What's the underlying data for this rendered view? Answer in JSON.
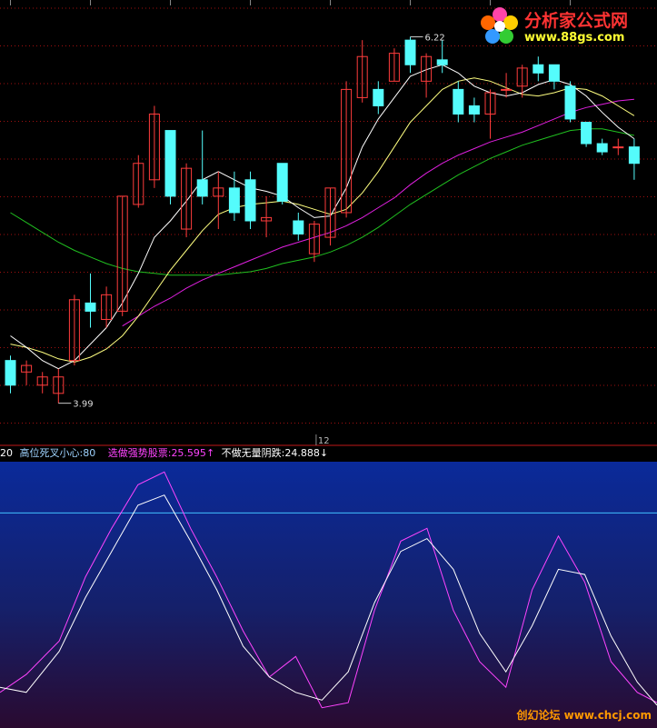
{
  "watermark": {
    "title": "分析家公式网",
    "url": "www.88gs.com"
  },
  "footer_watermark": "创幻论坛 www.chcj.com",
  "info_bar": {
    "period": "20",
    "item1_label": "高位死叉小心:",
    "item1_value": "80",
    "item2_label": "选做强势股票:",
    "item2_value": "25.595",
    "item2_arrow": "↑",
    "item3_label": "不做无量阴跌:",
    "item3_value": "24.888",
    "item3_arrow": "↓"
  },
  "colors": {
    "up": "#ff3c3c",
    "down": "#54fcfc",
    "ma_short": "#ffffff",
    "ma_mid": "#ffff80",
    "ma_magenta": "#e020e0",
    "ma_green": "#20c020",
    "osc_magenta": "#ff44ff",
    "osc_white": "#ffffff",
    "osc_threshold": "#40c0ff",
    "grid": "#a01010"
  },
  "chart_data": [
    {
      "type": "candlestick",
      "price_range": [
        3.8,
        6.4
      ],
      "high_label": "6.22",
      "low_label": "3.99",
      "x_marker": "12",
      "candles": [
        {
          "o": 4.25,
          "h": 4.28,
          "l": 4.05,
          "c": 4.1
        },
        {
          "o": 4.18,
          "h": 4.25,
          "l": 4.1,
          "c": 4.22
        },
        {
          "o": 4.1,
          "h": 4.18,
          "l": 4.05,
          "c": 4.15
        },
        {
          "o": 4.05,
          "h": 4.2,
          "l": 3.99,
          "c": 4.15
        },
        {
          "o": 4.25,
          "h": 4.65,
          "l": 4.22,
          "c": 4.62
        },
        {
          "o": 4.6,
          "h": 4.78,
          "l": 4.45,
          "c": 4.55
        },
        {
          "o": 4.5,
          "h": 4.7,
          "l": 4.45,
          "c": 4.65
        },
        {
          "o": 4.55,
          "h": 5.25,
          "l": 4.52,
          "c": 5.25
        },
        {
          "o": 5.2,
          "h": 5.5,
          "l": 5.18,
          "c": 5.45
        },
        {
          "o": 5.35,
          "h": 5.8,
          "l": 5.3,
          "c": 5.75
        },
        {
          "o": 5.65,
          "h": 5.65,
          "l": 5.2,
          "c": 5.25
        },
        {
          "o": 5.05,
          "h": 5.45,
          "l": 5.0,
          "c": 5.42
        },
        {
          "o": 5.35,
          "h": 5.65,
          "l": 5.2,
          "c": 5.25
        },
        {
          "o": 5.25,
          "h": 5.4,
          "l": 5.05,
          "c": 5.3
        },
        {
          "o": 5.3,
          "h": 5.4,
          "l": 5.1,
          "c": 5.15
        },
        {
          "o": 5.35,
          "h": 5.4,
          "l": 5.05,
          "c": 5.1
        },
        {
          "o": 5.1,
          "h": 5.25,
          "l": 5.0,
          "c": 5.12
        },
        {
          "o": 5.45,
          "h": 5.45,
          "l": 5.2,
          "c": 5.22
        },
        {
          "o": 5.1,
          "h": 5.15,
          "l": 4.98,
          "c": 5.02
        },
        {
          "o": 4.9,
          "h": 5.1,
          "l": 4.85,
          "c": 5.08
        },
        {
          "o": 5.0,
          "h": 5.3,
          "l": 4.95,
          "c": 5.3
        },
        {
          "o": 5.15,
          "h": 5.95,
          "l": 5.12,
          "c": 5.9
        },
        {
          "o": 5.85,
          "h": 6.2,
          "l": 5.82,
          "c": 6.1
        },
        {
          "o": 5.9,
          "h": 5.95,
          "l": 5.75,
          "c": 5.8
        },
        {
          "o": 5.95,
          "h": 6.15,
          "l": 5.95,
          "c": 6.12
        },
        {
          "o": 6.2,
          "h": 6.22,
          "l": 6.0,
          "c": 6.05
        },
        {
          "o": 5.95,
          "h": 6.12,
          "l": 5.85,
          "c": 6.1
        },
        {
          "o": 6.08,
          "h": 6.2,
          "l": 6.0,
          "c": 6.05
        },
        {
          "o": 5.9,
          "h": 5.95,
          "l": 5.7,
          "c": 5.75
        },
        {
          "o": 5.8,
          "h": 5.85,
          "l": 5.7,
          "c": 5.75
        },
        {
          "o": 5.75,
          "h": 5.9,
          "l": 5.6,
          "c": 5.88
        },
        {
          "o": 5.9,
          "h": 6.0,
          "l": 5.85,
          "c": 5.9
        },
        {
          "o": 5.92,
          "h": 6.05,
          "l": 5.85,
          "c": 6.03
        },
        {
          "o": 6.05,
          "h": 6.1,
          "l": 5.95,
          "c": 6.0
        },
        {
          "o": 6.05,
          "h": 6.05,
          "l": 5.9,
          "c": 5.95
        },
        {
          "o": 5.92,
          "h": 5.95,
          "l": 5.7,
          "c": 5.72
        },
        {
          "o": 5.7,
          "h": 5.7,
          "l": 5.55,
          "c": 5.57
        },
        {
          "o": 5.57,
          "h": 5.6,
          "l": 5.5,
          "c": 5.52
        },
        {
          "o": 5.55,
          "h": 5.6,
          "l": 5.5,
          "c": 5.55
        },
        {
          "o": 5.55,
          "h": 5.6,
          "l": 5.35,
          "c": 5.45
        }
      ],
      "ma_short": [
        4.4,
        4.33,
        4.25,
        4.2,
        4.25,
        4.35,
        4.45,
        4.6,
        4.78,
        5.0,
        5.1,
        5.22,
        5.35,
        5.4,
        5.35,
        5.3,
        5.28,
        5.25,
        5.18,
        5.12,
        5.13,
        5.3,
        5.55,
        5.72,
        5.85,
        5.98,
        6.02,
        6.05,
        6.0,
        5.92,
        5.88,
        5.86,
        5.88,
        5.93,
        5.96,
        5.93,
        5.86,
        5.76,
        5.67,
        5.6
      ],
      "ma_mid": [
        4.35,
        4.33,
        4.3,
        4.26,
        4.24,
        4.27,
        4.32,
        4.4,
        4.52,
        4.66,
        4.8,
        4.92,
        5.04,
        5.14,
        5.18,
        5.2,
        5.21,
        5.22,
        5.2,
        5.17,
        5.14,
        5.17,
        5.27,
        5.4,
        5.55,
        5.7,
        5.8,
        5.9,
        5.95,
        5.97,
        5.95,
        5.91,
        5.87,
        5.86,
        5.88,
        5.91,
        5.9,
        5.86,
        5.8,
        5.74
      ],
      "ma_magenta": [
        null,
        null,
        null,
        null,
        null,
        null,
        null,
        4.46,
        4.52,
        4.58,
        4.63,
        4.69,
        4.74,
        4.78,
        4.82,
        4.86,
        4.9,
        4.94,
        4.97,
        5.0,
        5.03,
        5.07,
        5.12,
        5.18,
        5.24,
        5.32,
        5.39,
        5.45,
        5.5,
        5.54,
        5.58,
        5.61,
        5.64,
        5.68,
        5.72,
        5.76,
        5.79,
        5.81,
        5.83,
        5.84
      ],
      "ma_green": [
        5.15,
        5.09,
        5.03,
        4.97,
        4.92,
        4.88,
        4.84,
        4.81,
        4.79,
        4.78,
        4.77,
        4.77,
        4.77,
        4.77,
        4.78,
        4.79,
        4.81,
        4.84,
        4.86,
        4.88,
        4.91,
        4.95,
        5.0,
        5.06,
        5.13,
        5.2,
        5.26,
        5.32,
        5.38,
        5.43,
        5.48,
        5.52,
        5.56,
        5.59,
        5.62,
        5.65,
        5.66,
        5.66,
        5.64,
        5.62
      ]
    },
    {
      "type": "line",
      "y_range": [
        0,
        100
      ],
      "threshold": 80,
      "x": [
        0,
        4,
        9,
        13,
        17,
        21,
        25,
        29,
        33,
        37,
        41,
        45,
        49,
        53,
        57,
        61,
        65,
        69,
        73,
        77,
        81,
        85,
        89,
        93,
        97,
        100
      ],
      "series": [
        {
          "values": [
            10,
            17,
            30,
            55,
            74,
            91,
            96,
            74,
            55,
            34,
            16,
            24,
            4,
            6,
            42,
            69,
            74,
            42,
            22,
            12,
            50,
            71,
            53,
            22,
            10,
            6
          ]
        },
        {
          "values": [
            12,
            10,
            26,
            47,
            65,
            83,
            87,
            69,
            50,
            28,
            16,
            10,
            7,
            18,
            45,
            65,
            70,
            58,
            33,
            18,
            36,
            58,
            56,
            32,
            14,
            5
          ]
        }
      ]
    }
  ]
}
